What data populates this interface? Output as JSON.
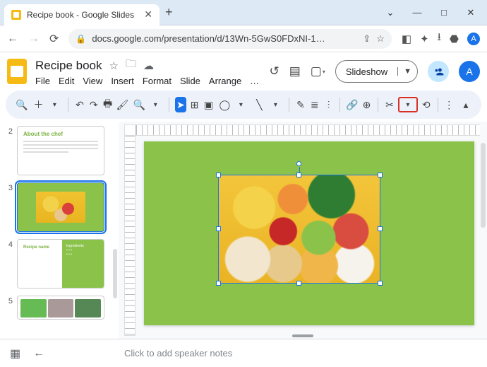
{
  "window": {
    "tab_title": "Recipe book - Google Slides",
    "minimize": "—",
    "maximize": "□",
    "close": "✕"
  },
  "addr": {
    "url": "docs.google.com/presentation/d/13Wn-5GwS0FDxNI-1…",
    "avatar_letter": "A"
  },
  "doc": {
    "title": "Recipe book",
    "menus": [
      "File",
      "Edit",
      "View",
      "Insert",
      "Format",
      "Slide",
      "Arrange",
      "…"
    ]
  },
  "header_right": {
    "slideshow": "Slideshow",
    "avatar_letter": "A"
  },
  "toolbar_chevron": "▴",
  "filmstrip": {
    "slides": [
      {
        "num": "2",
        "type": "title",
        "title": "About the chef"
      },
      {
        "num": "3",
        "type": "green-food",
        "selected": true
      },
      {
        "num": "4",
        "type": "split",
        "title": "Recipe name",
        "right_heading": "Ingredients"
      },
      {
        "num": "5",
        "type": "collage"
      }
    ]
  },
  "canvas": {
    "image_desc": "Top-down photo of assorted healthy foods on yellow background"
  },
  "speaker_notes_placeholder": "Click to add speaker notes"
}
